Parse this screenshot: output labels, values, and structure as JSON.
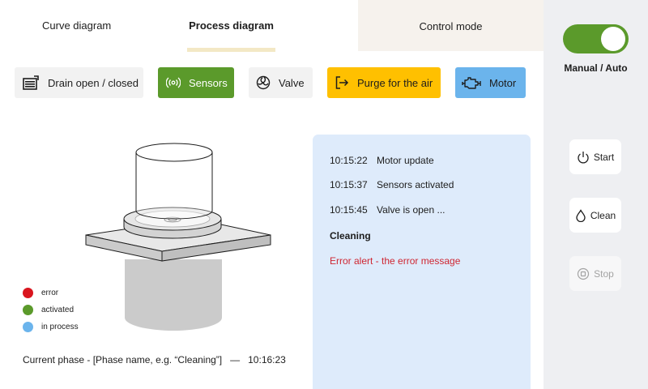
{
  "tabs": {
    "curve": "Curve diagram",
    "process": "Process diagram",
    "control": "Control mode"
  },
  "toolbar": {
    "drain": {
      "label": "Drain open / closed",
      "icon": "drain-icon"
    },
    "sensors": {
      "label": "Sensors",
      "icon": "sensors-icon",
      "color": "#5b9a2b"
    },
    "valve": {
      "label": "Valve",
      "icon": "valve-icon"
    },
    "purge": {
      "label": "Purge for the air",
      "icon": "purge-icon",
      "color": "#ffc000"
    },
    "motor": {
      "label": "Motor",
      "icon": "motor-icon",
      "color": "#6bb4ec"
    }
  },
  "legend": [
    {
      "label": "error",
      "color": "#d9151e"
    },
    {
      "label": "activated",
      "color": "#5b9a2b"
    },
    {
      "label": "in process",
      "color": "#6bb4ec"
    }
  ],
  "current_phase": "Current phase - [Phase name, e.g. “Cleaning”]   —   10:16:23",
  "log": {
    "entries": [
      {
        "time": "10:15:22",
        "message": "Motor update"
      },
      {
        "time": "10:15:37",
        "message": "Sensors activated"
      },
      {
        "time": "10:15:45",
        "message": "Valve is open ..."
      }
    ],
    "section": "Cleaning",
    "error": "Error alert - the error message"
  },
  "mode": {
    "label": "Manual / Auto",
    "toggle_on": true
  },
  "controls": {
    "start": "Start",
    "clean": "Clean",
    "stop": "Stop"
  }
}
